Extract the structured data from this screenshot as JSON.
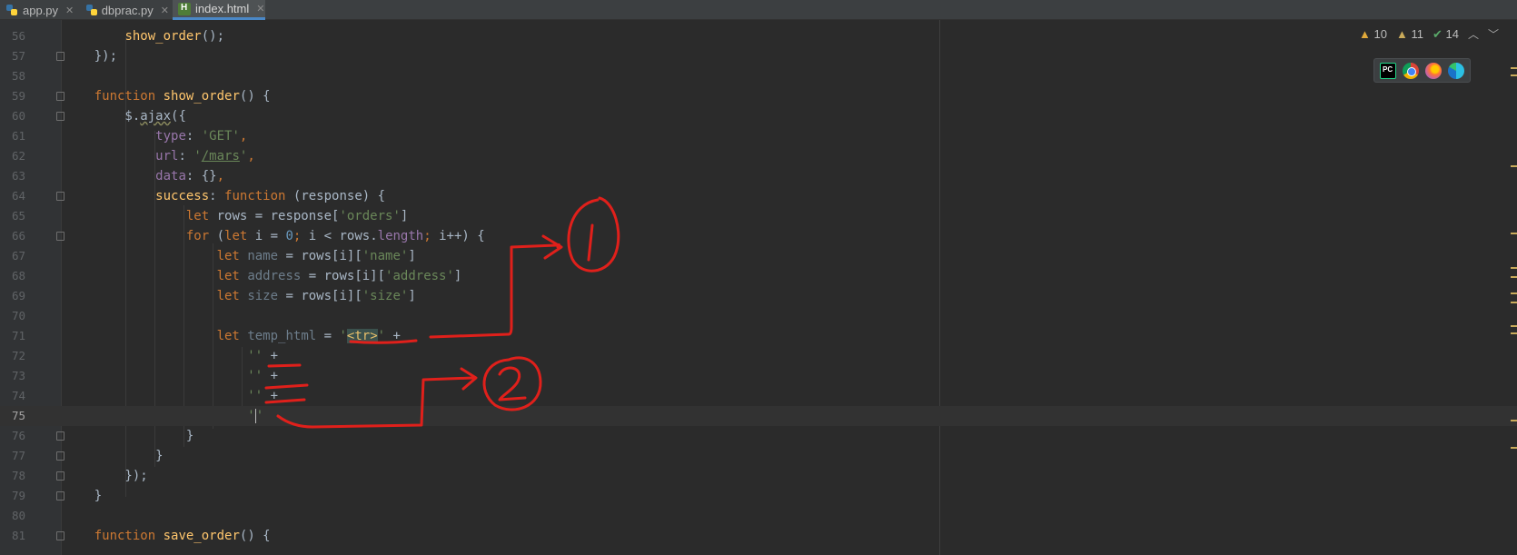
{
  "tabs": [
    {
      "label": "app.py",
      "icon": "python-file-icon"
    },
    {
      "label": "dbprac.py",
      "icon": "python-file-icon"
    },
    {
      "label": "index.html",
      "icon": "html-file-icon",
      "active": true
    }
  ],
  "inspections": {
    "warnings": "10",
    "weak_warnings": "11",
    "ok": "14"
  },
  "browsers": [
    "pycharm-icon",
    "chrome-icon",
    "firefox-icon",
    "edge-icon"
  ],
  "editor": {
    "current_line": 75,
    "lines": [
      {
        "n": "56",
        "text": "        show_order();"
      },
      {
        "n": "57",
        "text": "    });"
      },
      {
        "n": "58",
        "text": ""
      },
      {
        "n": "59",
        "text": "    function show_order() {"
      },
      {
        "n": "60",
        "text": "        $.ajax({"
      },
      {
        "n": "61",
        "text": "            type: 'GET',"
      },
      {
        "n": "62",
        "text": "            url: '/mars',"
      },
      {
        "n": "63",
        "text": "            data: {},"
      },
      {
        "n": "64",
        "text": "            success: function (response) {"
      },
      {
        "n": "65",
        "text": "                let rows = response['orders']"
      },
      {
        "n": "66",
        "text": "                for (let i = 0; i < rows.length; i++) {"
      },
      {
        "n": "67",
        "text": "                    let name = rows[i]['name']"
      },
      {
        "n": "68",
        "text": "                    let address = rows[i]['address']"
      },
      {
        "n": "69",
        "text": "                    let size = rows[i]['size']"
      },
      {
        "n": "70",
        "text": ""
      },
      {
        "n": "71",
        "text": "                    let temp_html = '<tr>' +"
      },
      {
        "n": "72",
        "text": "                        '' +"
      },
      {
        "n": "73",
        "text": "                        '' +"
      },
      {
        "n": "74",
        "text": "                        '' +"
      },
      {
        "n": "75",
        "text": "                        ''"
      },
      {
        "n": "76",
        "text": "                }"
      },
      {
        "n": "77",
        "text": "            }"
      },
      {
        "n": "78",
        "text": "        });"
      },
      {
        "n": "79",
        "text": "    }"
      },
      {
        "n": "80",
        "text": ""
      },
      {
        "n": "81",
        "text": "    function save_order() {"
      }
    ]
  },
  "annotations": {
    "mark_1": "1",
    "mark_2": "2",
    "color": "#e0201b"
  }
}
